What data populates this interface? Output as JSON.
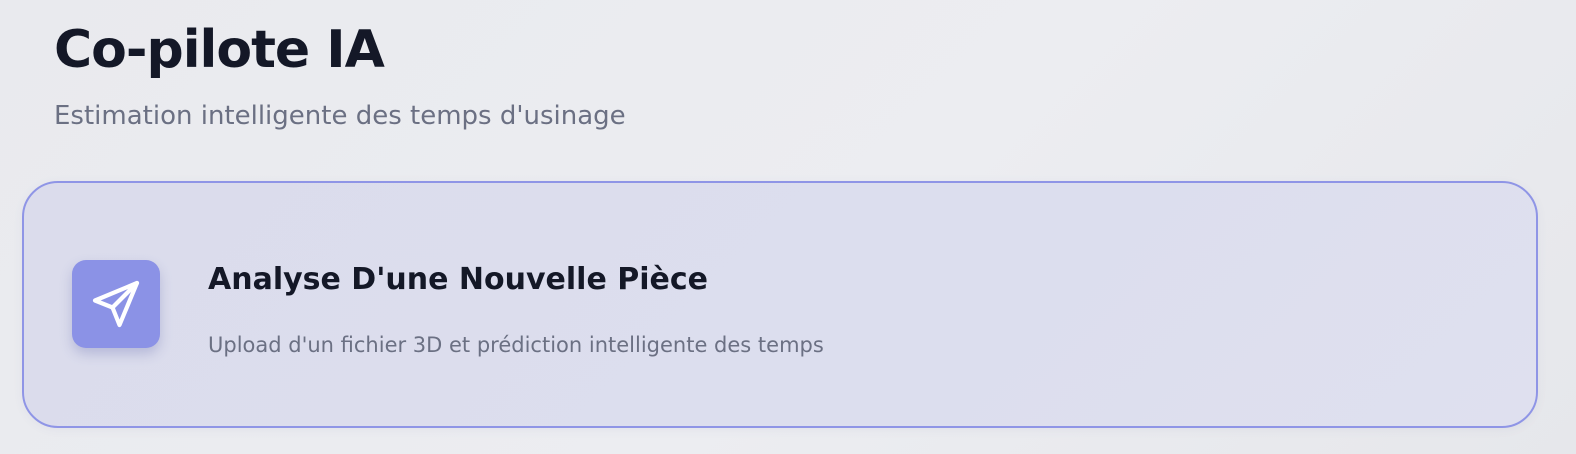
{
  "header": {
    "title": "Co-pilote IA",
    "subtitle": "Estimation intelligente des temps d'usinage"
  },
  "card": {
    "icon": "paper-plane-icon",
    "title": "Analyse D'une Nouvelle Pièce",
    "description": "Upload d'un fichier 3D et prédiction intelligente des temps"
  },
  "colors": {
    "accent": "#8b92e6",
    "card_border": "#8f95e6",
    "title_text": "#141827",
    "secondary_text": "#6b7083"
  }
}
